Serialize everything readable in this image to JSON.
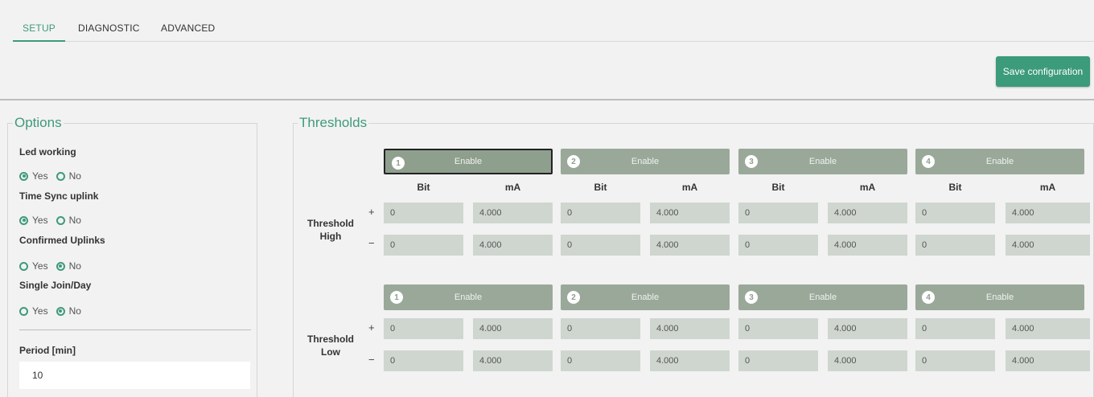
{
  "tabs": [
    "SETUP",
    "DIAGNOSTIC",
    "ADVANCED"
  ],
  "toolbar": {
    "save_label": "Save configuration"
  },
  "options": {
    "legend": "Options",
    "yes_label": "Yes",
    "no_label": "No",
    "items": [
      {
        "label": "Led working",
        "value": "Yes"
      },
      {
        "label": "Time Sync uplink",
        "value": "Yes"
      },
      {
        "label": "Confirmed Uplinks",
        "value": "No"
      },
      {
        "label": "Single Join/Day",
        "value": "No"
      }
    ],
    "period_label": "Period [min]",
    "period_value": "10"
  },
  "thresholds": {
    "legend": "Thresholds",
    "enable_label": "Enable",
    "channel_numbers": [
      "1",
      "2",
      "3",
      "4"
    ],
    "bit_header": "Bit",
    "ma_header": "mA",
    "plus": "+",
    "minus": "−",
    "high": {
      "label_line1": "Threshold",
      "label_line2": "High",
      "plus_values": [
        [
          "0",
          "4.000"
        ],
        [
          "0",
          "4.000"
        ],
        [
          "0",
          "4.000"
        ],
        [
          "0",
          "4.000"
        ]
      ],
      "minus_values": [
        [
          "0",
          "4.000"
        ],
        [
          "0",
          "4.000"
        ],
        [
          "0",
          "4.000"
        ],
        [
          "0",
          "4.000"
        ]
      ]
    },
    "low": {
      "label_line1": "Threshold",
      "label_line2": "Low",
      "plus_values": [
        [
          "0",
          "4.000"
        ],
        [
          "0",
          "4.000"
        ],
        [
          "0",
          "4.000"
        ],
        [
          "0",
          "4.000"
        ]
      ],
      "minus_values": [
        [
          "0",
          "4.000"
        ],
        [
          "0",
          "4.000"
        ],
        [
          "0",
          "4.000"
        ],
        [
          "0",
          "4.000"
        ]
      ]
    }
  }
}
